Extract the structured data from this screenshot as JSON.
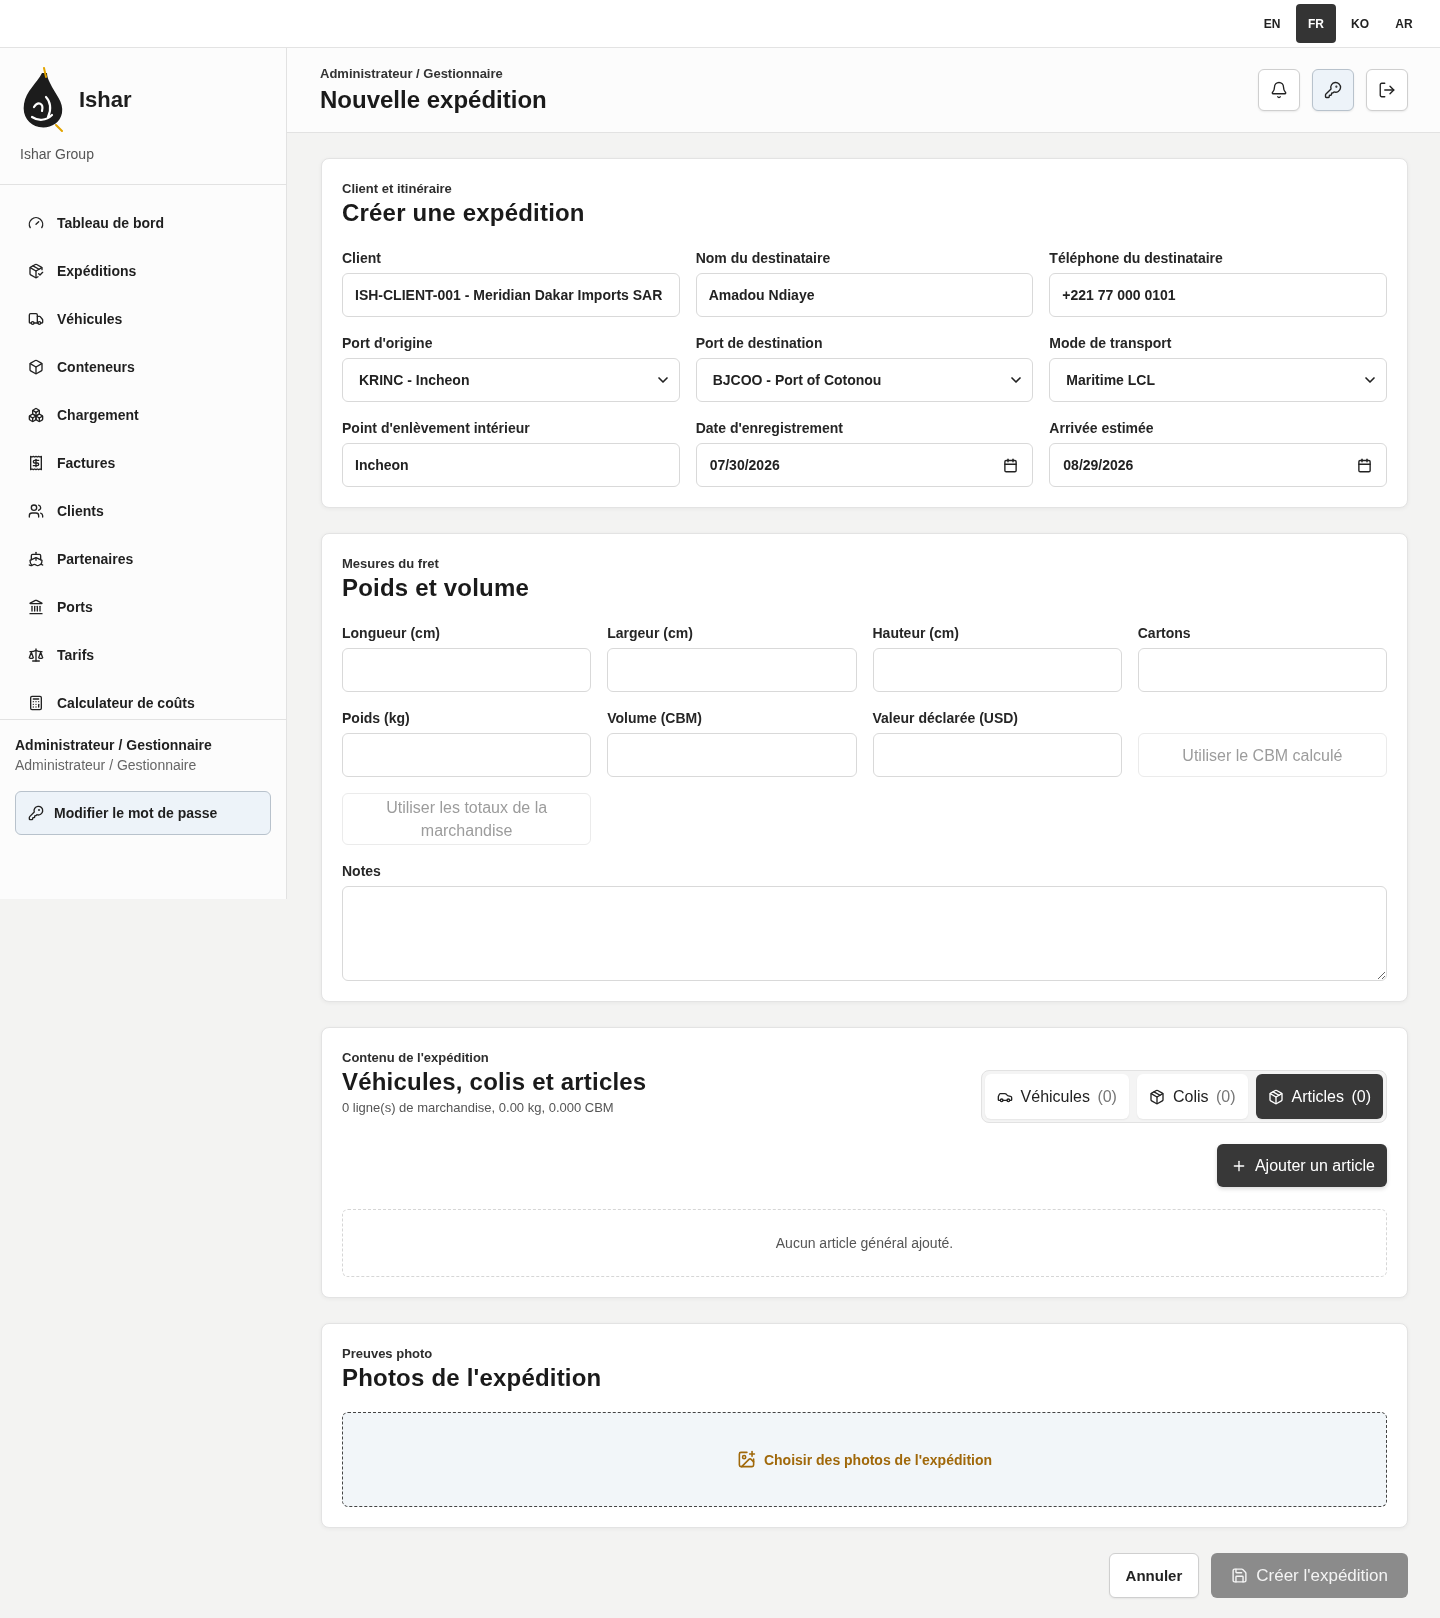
{
  "language_switcher": [
    {
      "label": "EN",
      "selected": false
    },
    {
      "label": "FR",
      "selected": true
    },
    {
      "label": "KO",
      "selected": false
    },
    {
      "label": "AR",
      "selected": false
    }
  ],
  "sidebar": {
    "brand": {
      "name": "Ishar",
      "company": "Ishar Group"
    },
    "nav": [
      {
        "label": "Tableau de bord",
        "selected": false
      },
      {
        "label": "Expéditions",
        "selected": false
      },
      {
        "label": "Véhicules",
        "selected": false
      },
      {
        "label": "Conteneurs",
        "selected": false
      },
      {
        "label": "Chargement",
        "selected": false
      },
      {
        "label": "Factures",
        "selected": false
      },
      {
        "label": "Clients",
        "selected": false
      },
      {
        "label": "Partenaires",
        "selected": false
      },
      {
        "label": "Ports",
        "selected": false
      },
      {
        "label": "Tarifs",
        "selected": false
      },
      {
        "label": "Calculateur de coûts",
        "selected": false
      }
    ],
    "user": {
      "name": "Administrateur / Gestionnaire",
      "role": "Administrateur / Gestionnaire"
    },
    "password_button": "Modifier le mot de passe"
  },
  "header": {
    "breadcrumb": "Administrateur / Gestionnaire",
    "title": "Nouvelle expédition",
    "actions": [
      {
        "highlighted": false
      },
      {
        "highlighted": true
      },
      {
        "highlighted": false
      }
    ]
  },
  "client_section": {
    "eyebrow": "Client et itinéraire",
    "title": "Créer une expédition",
    "fields": [
      {
        "label": "Client",
        "kind": "text",
        "value": "ISH-CLIENT-001 - Meridian Dakar Imports SAR"
      },
      {
        "label": "Nom du destinataire",
        "kind": "text",
        "value": "Amadou Ndiaye"
      },
      {
        "label": "Téléphone du destinataire",
        "kind": "text",
        "value": "+221 77 000 0101"
      },
      {
        "label": "Port d'origine",
        "kind": "select",
        "value": "KRINC - Incheon"
      },
      {
        "label": "Port de destination",
        "kind": "select",
        "value": "BJCOO - Port of Cotonou"
      },
      {
        "label": "Mode de transport",
        "kind": "select",
        "value": "Maritime LCL"
      },
      {
        "label": "Point d'enlèvement intérieur",
        "kind": "text",
        "value": "Incheon"
      },
      {
        "label": "Date d'enregistrement",
        "kind": "date",
        "value": "07/30/2026"
      },
      {
        "label": "Arrivée estimée",
        "kind": "date",
        "value": "08/29/2026"
      }
    ]
  },
  "freight_section": {
    "eyebrow": "Mesures du fret",
    "title": "Poids et volume",
    "items": [
      {
        "kind": "field",
        "label": "Longueur (cm)"
      },
      {
        "kind": "field",
        "label": "Largeur (cm)"
      },
      {
        "kind": "field",
        "label": "Hauteur (cm)"
      },
      {
        "kind": "field",
        "label": "Cartons"
      },
      {
        "kind": "field",
        "label": "Poids (kg)"
      },
      {
        "kind": "field",
        "label": "Volume (CBM)"
      },
      {
        "kind": "field",
        "label": "Valeur déclarée (USD)"
      },
      {
        "kind": "button",
        "label": "Utiliser le CBM calculé",
        "disabled": true
      },
      {
        "kind": "button",
        "label": "Utiliser les totaux de la marchandise",
        "disabled": true
      }
    ],
    "notes": {
      "label": "Notes"
    }
  },
  "contents_section": {
    "eyebrow": "Contenu de l'expédition",
    "title": "Véhicules, colis et articles",
    "summary": "0 ligne(s) de marchandise, 0.00 kg, 0.000 CBM",
    "tabs": [
      {
        "label": "Véhicules",
        "count": "(0)",
        "selected": false
      },
      {
        "label": "Colis",
        "count": "(0)",
        "selected": false
      },
      {
        "label": "Articles",
        "count": "(0)",
        "selected": true
      }
    ],
    "add_button": "Ajouter un article",
    "empty_message": "Aucun article général ajouté."
  },
  "photos_section": {
    "eyebrow": "Preuves photo",
    "title": "Photos de l'expédition",
    "upload_label": "Choisir des photos de l'expédition"
  },
  "footer": {
    "cancel": "Annuler",
    "submit": {
      "label": "Créer l'expédition",
      "disabled": true
    }
  }
}
